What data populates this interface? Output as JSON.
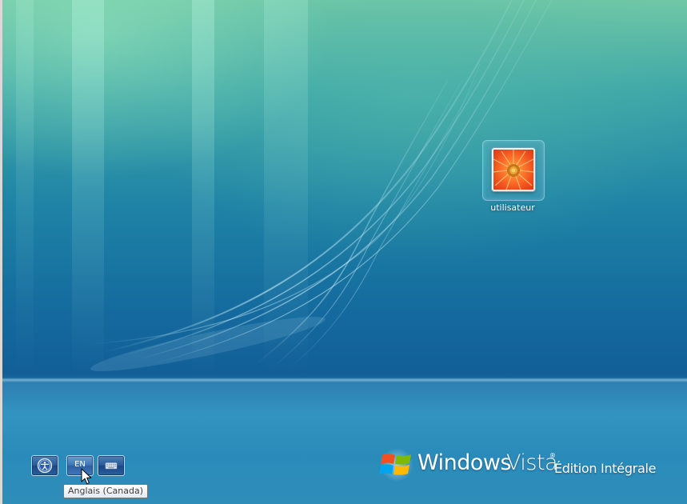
{
  "user": {
    "name": "utilisateur",
    "picture_icon": "orange-flower-icon"
  },
  "toolbar": {
    "ease_of_access_icon": "ease-of-access-icon",
    "language_indicator": "EN",
    "on_screen_keyboard_icon": "keyboard-icon"
  },
  "tooltip": {
    "text": "Anglais (Canada)"
  },
  "branding": {
    "logo_icon": "windows-flag-icon",
    "windows": "Windows",
    "vista": "Vista",
    "trademark": "®",
    "edition": "Édition Intégrale"
  },
  "colors": {
    "wallpaper_top": "#6fc7a6",
    "wallpaper_mid": "#1f84a6",
    "wallpaper_bottom": "#2b8ab8",
    "button_blue": "#2a5a98",
    "tooltip_bg": "#ffffff"
  }
}
